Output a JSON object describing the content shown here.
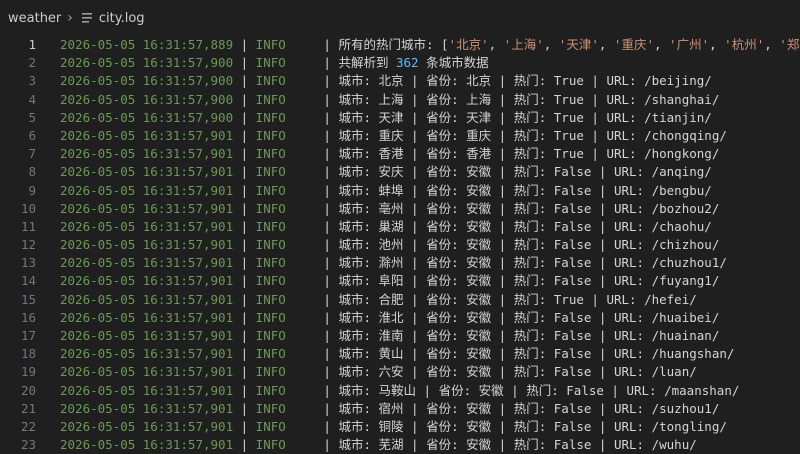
{
  "breadcrumb": {
    "folder": "weather",
    "file": "city.log"
  },
  "colors": {
    "timestamp": "#6a9955",
    "number": "#4fc1ff",
    "string": "#ce9178",
    "text": "#d4d4d4",
    "background": "#1f1f1f"
  },
  "lines": [
    {
      "n": "1",
      "ts": "2026-05-05 16:31:57,889",
      "lvl": "INFO",
      "msg": "所有的热门城市: [",
      "strs": [
        "'北京'",
        "'上海'",
        "'天津'",
        "'重庆'",
        "'广州'",
        "'杭州'",
        "'郑州'"
      ]
    },
    {
      "n": "2",
      "ts": "2026-05-05 16:31:57,900",
      "lvl": "INFO",
      "pre": "共解析到 ",
      "num": "362",
      "post": " 条城市数据"
    },
    {
      "n": "3",
      "ts": "2026-05-05 16:31:57,900",
      "lvl": "INFO",
      "msg": "城市: 北京 | 省份: 北京 | 热门: True | URL: /beijing/"
    },
    {
      "n": "4",
      "ts": "2026-05-05 16:31:57,900",
      "lvl": "INFO",
      "msg": "城市: 上海 | 省份: 上海 | 热门: True | URL: /shanghai/"
    },
    {
      "n": "5",
      "ts": "2026-05-05 16:31:57,900",
      "lvl": "INFO",
      "msg": "城市: 天津 | 省份: 天津 | 热门: True | URL: /tianjin/"
    },
    {
      "n": "6",
      "ts": "2026-05-05 16:31:57,901",
      "lvl": "INFO",
      "msg": "城市: 重庆 | 省份: 重庆 | 热门: True | URL: /chongqing/"
    },
    {
      "n": "7",
      "ts": "2026-05-05 16:31:57,901",
      "lvl": "INFO",
      "msg": "城市: 香港 | 省份: 香港 | 热门: True | URL: /hongkong/"
    },
    {
      "n": "8",
      "ts": "2026-05-05 16:31:57,901",
      "lvl": "INFO",
      "msg": "城市: 安庆 | 省份: 安徽 | 热门: False | URL: /anqing/"
    },
    {
      "n": "9",
      "ts": "2026-05-05 16:31:57,901",
      "lvl": "INFO",
      "msg": "城市: 蚌埠 | 省份: 安徽 | 热门: False | URL: /bengbu/"
    },
    {
      "n": "10",
      "ts": "2026-05-05 16:31:57,901",
      "lvl": "INFO",
      "msg": "城市: 亳州 | 省份: 安徽 | 热门: False | URL: /bozhou2/"
    },
    {
      "n": "11",
      "ts": "2026-05-05 16:31:57,901",
      "lvl": "INFO",
      "msg": "城市: 巢湖 | 省份: 安徽 | 热门: False | URL: /chaohu/"
    },
    {
      "n": "12",
      "ts": "2026-05-05 16:31:57,901",
      "lvl": "INFO",
      "msg": "城市: 池州 | 省份: 安徽 | 热门: False | URL: /chizhou/"
    },
    {
      "n": "13",
      "ts": "2026-05-05 16:31:57,901",
      "lvl": "INFO",
      "msg": "城市: 滁州 | 省份: 安徽 | 热门: False | URL: /chuzhou1/"
    },
    {
      "n": "14",
      "ts": "2026-05-05 16:31:57,901",
      "lvl": "INFO",
      "msg": "城市: 阜阳 | 省份: 安徽 | 热门: False | URL: /fuyang1/"
    },
    {
      "n": "15",
      "ts": "2026-05-05 16:31:57,901",
      "lvl": "INFO",
      "msg": "城市: 合肥 | 省份: 安徽 | 热门: True | URL: /hefei/"
    },
    {
      "n": "16",
      "ts": "2026-05-05 16:31:57,901",
      "lvl": "INFO",
      "msg": "城市: 淮北 | 省份: 安徽 | 热门: False | URL: /huaibei/"
    },
    {
      "n": "17",
      "ts": "2026-05-05 16:31:57,901",
      "lvl": "INFO",
      "msg": "城市: 淮南 | 省份: 安徽 | 热门: False | URL: /huainan/"
    },
    {
      "n": "18",
      "ts": "2026-05-05 16:31:57,901",
      "lvl": "INFO",
      "msg": "城市: 黄山 | 省份: 安徽 | 热门: False | URL: /huangshan/"
    },
    {
      "n": "19",
      "ts": "2026-05-05 16:31:57,901",
      "lvl": "INFO",
      "msg": "城市: 六安 | 省份: 安徽 | 热门: False | URL: /luan/"
    },
    {
      "n": "20",
      "ts": "2026-05-05 16:31:57,901",
      "lvl": "INFO",
      "msg": "城市: 马鞍山 | 省份: 安徽 | 热门: False | URL: /maanshan/"
    },
    {
      "n": "21",
      "ts": "2026-05-05 16:31:57,901",
      "lvl": "INFO",
      "msg": "城市: 宿州 | 省份: 安徽 | 热门: False | URL: /suzhou1/"
    },
    {
      "n": "22",
      "ts": "2026-05-05 16:31:57,901",
      "lvl": "INFO",
      "msg": "城市: 铜陵 | 省份: 安徽 | 热门: False | URL: /tongling/"
    },
    {
      "n": "23",
      "ts": "2026-05-05 16:31:57,901",
      "lvl": "INFO",
      "msg": "城市: 芜湖 | 省份: 安徽 | 热门: False | URL: /wuhu/"
    }
  ]
}
